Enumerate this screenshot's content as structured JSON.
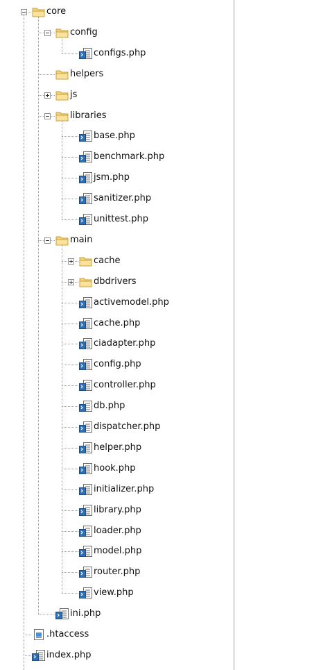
{
  "tree": [
    {
      "label": "core",
      "type": "folder",
      "depth": 0,
      "state": "expanded",
      "last": false
    },
    {
      "label": "config",
      "type": "folder",
      "depth": 1,
      "state": "expanded",
      "last": false
    },
    {
      "label": "configs.php",
      "type": "php",
      "depth": 2,
      "state": "none",
      "last": true
    },
    {
      "label": "helpers",
      "type": "folder",
      "depth": 1,
      "state": "none",
      "last": false
    },
    {
      "label": "js",
      "type": "folder",
      "depth": 1,
      "state": "collapsed",
      "last": false
    },
    {
      "label": "libraries",
      "type": "folder",
      "depth": 1,
      "state": "expanded",
      "last": false
    },
    {
      "label": "base.php",
      "type": "php",
      "depth": 2,
      "state": "none",
      "last": false
    },
    {
      "label": "benchmark.php",
      "type": "php",
      "depth": 2,
      "state": "none",
      "last": false
    },
    {
      "label": "jsm.php",
      "type": "php",
      "depth": 2,
      "state": "none",
      "last": false
    },
    {
      "label": "sanitizer.php",
      "type": "php",
      "depth": 2,
      "state": "none",
      "last": false
    },
    {
      "label": "unittest.php",
      "type": "php",
      "depth": 2,
      "state": "none",
      "last": true
    },
    {
      "label": "main",
      "type": "folder",
      "depth": 1,
      "state": "expanded",
      "last": false
    },
    {
      "label": "cache",
      "type": "folder",
      "depth": 2,
      "state": "collapsed",
      "last": false
    },
    {
      "label": "dbdrivers",
      "type": "folder",
      "depth": 2,
      "state": "collapsed",
      "last": false
    },
    {
      "label": "activemodel.php",
      "type": "php",
      "depth": 2,
      "state": "none",
      "last": false
    },
    {
      "label": "cache.php",
      "type": "php",
      "depth": 2,
      "state": "none",
      "last": false
    },
    {
      "label": "ciadapter.php",
      "type": "php",
      "depth": 2,
      "state": "none",
      "last": false
    },
    {
      "label": "config.php",
      "type": "php",
      "depth": 2,
      "state": "none",
      "last": false
    },
    {
      "label": "controller.php",
      "type": "php",
      "depth": 2,
      "state": "none",
      "last": false
    },
    {
      "label": "db.php",
      "type": "php",
      "depth": 2,
      "state": "none",
      "last": false
    },
    {
      "label": "dispatcher.php",
      "type": "php",
      "depth": 2,
      "state": "none",
      "last": false
    },
    {
      "label": "helper.php",
      "type": "php",
      "depth": 2,
      "state": "none",
      "last": false
    },
    {
      "label": "hook.php",
      "type": "php",
      "depth": 2,
      "state": "none",
      "last": false
    },
    {
      "label": "initializer.php",
      "type": "php",
      "depth": 2,
      "state": "none",
      "last": false
    },
    {
      "label": "library.php",
      "type": "php",
      "depth": 2,
      "state": "none",
      "last": false
    },
    {
      "label": "loader.php",
      "type": "php",
      "depth": 2,
      "state": "none",
      "last": false
    },
    {
      "label": "model.php",
      "type": "php",
      "depth": 2,
      "state": "none",
      "last": false
    },
    {
      "label": "router.php",
      "type": "php",
      "depth": 2,
      "state": "none",
      "last": false
    },
    {
      "label": "view.php",
      "type": "php",
      "depth": 2,
      "state": "none",
      "last": true
    },
    {
      "label": "ini.php",
      "type": "php",
      "depth": 1,
      "state": "none",
      "last": true
    },
    {
      "label": ".htaccess",
      "type": "text",
      "depth": 0,
      "state": "none",
      "last": false
    },
    {
      "label": "index.php",
      "type": "php",
      "depth": 0,
      "state": "none",
      "last": false
    }
  ],
  "colors": {
    "folder_fill": "#f4d27a",
    "folder_edge": "#c9a13a",
    "php_blue": "#2f6fb3",
    "php_gray": "#6b6b6b",
    "guide_line": "#9a9a9a"
  }
}
